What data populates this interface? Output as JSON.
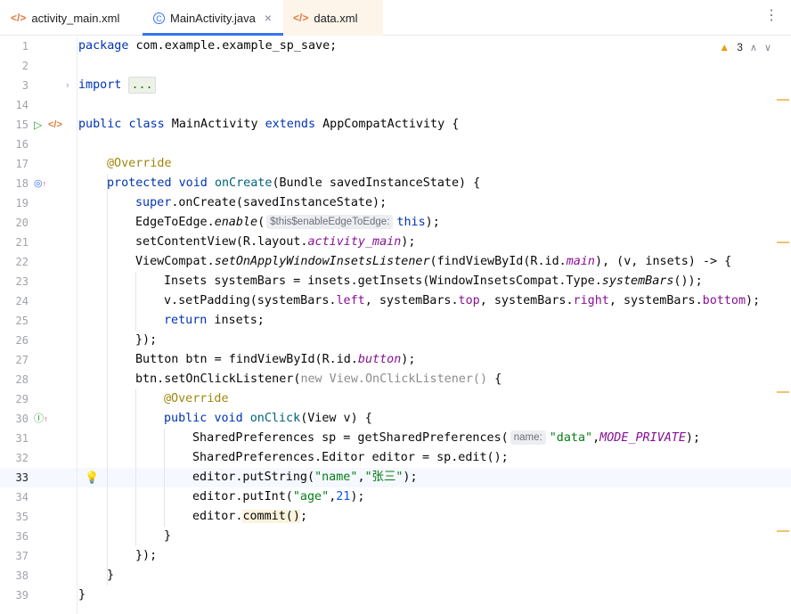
{
  "tabs": [
    {
      "label": "activity_main.xml",
      "icon": "xml-icon"
    },
    {
      "label": "MainActivity.java",
      "icon": "java-class-icon"
    },
    {
      "label": "data.xml",
      "icon": "xml-icon"
    }
  ],
  "inspection": {
    "warnings": "3"
  },
  "current_line": "33",
  "lines": [
    {
      "n": "1"
    },
    {
      "n": "2"
    },
    {
      "n": "3"
    },
    {
      "n": "14"
    },
    {
      "n": "15"
    },
    {
      "n": "16"
    },
    {
      "n": "17"
    },
    {
      "n": "18"
    },
    {
      "n": "19"
    },
    {
      "n": "20"
    },
    {
      "n": "21"
    },
    {
      "n": "22"
    },
    {
      "n": "23"
    },
    {
      "n": "24"
    },
    {
      "n": "25"
    },
    {
      "n": "26"
    },
    {
      "n": "27"
    },
    {
      "n": "28"
    },
    {
      "n": "29"
    },
    {
      "n": "30"
    },
    {
      "n": "31"
    },
    {
      "n": "32"
    },
    {
      "n": "33"
    },
    {
      "n": "34"
    },
    {
      "n": "35"
    },
    {
      "n": "36"
    },
    {
      "n": "37"
    },
    {
      "n": "38"
    },
    {
      "n": "39"
    }
  ],
  "code": {
    "l1": {
      "kw": "package",
      "rest": " com.example.example_sp_save;"
    },
    "l3": {
      "kw": "import",
      "fold": "..."
    },
    "l15": {
      "kw1": "public",
      "kw2": "class",
      "name": " MainActivity ",
      "kw3": "extends",
      "rest": " AppCompatActivity {"
    },
    "l17": {
      "ann": "@Override"
    },
    "l18": {
      "kw1": "protected",
      "kw2": "void",
      "name": "onCreate",
      "rest": "(Bundle savedInstanceState) {"
    },
    "l19": {
      "kw": "super",
      "rest": ".onCreate(savedInstanceState);"
    },
    "l20": {
      "a": "EdgeToEdge.",
      "method": "enable",
      "b": "(",
      "hint": "$this$enableEdgeToEdge:",
      "kw": "this",
      "c": ");"
    },
    "l21": {
      "a": "setContentView(R.layout.",
      "fld": "activity_main",
      "b": ");"
    },
    "l22": {
      "a": "ViewCompat.",
      "method": "setOnApplyWindowInsetsListener",
      "b": "(findViewById(R.id.",
      "fld": "main",
      "c": "), (v, insets) -> {"
    },
    "l23": {
      "a": "Insets systemBars = insets.getInsets(WindowInsetsCompat.Type.",
      "method": "systemBars",
      "b": "());"
    },
    "l24": {
      "a": "v.setPadding(systemBars.",
      "f1": "left",
      "b": ", systemBars.",
      "f2": "top",
      "c": ", systemBars.",
      "f3": "right",
      "d": ", systemBars.",
      "f4": "bottom",
      "e": ");"
    },
    "l25": {
      "kw": "return",
      "rest": " insets;"
    },
    "l26": {
      "text": "});"
    },
    "l27": {
      "a": "Button btn = findViewById(R.id.",
      "fld": "button",
      "b": ");"
    },
    "l28": {
      "a": "btn.setOnClickListener(",
      "gray": "new View.OnClickListener()",
      "b": " {"
    },
    "l29": {
      "ann": "@Override"
    },
    "l30": {
      "kw1": "public",
      "kw2": "void",
      "name": "onClick",
      "rest": "(View v) {"
    },
    "l31": {
      "a": "SharedPreferences sp = getSharedPreferences(",
      "hint": "name:",
      "str": "\"data\"",
      "b": ",",
      "fld": "MODE_PRIVATE",
      "c": ");"
    },
    "l32": {
      "text": "SharedPreferences.Editor editor = sp.edit();"
    },
    "l33": {
      "a": "editor.putString(",
      "s1": "\"name\"",
      "b": ",",
      "s2": "\"张三\"",
      "c": ");"
    },
    "l34": {
      "a": "editor.putInt(",
      "s1": "\"age\"",
      "b": ",",
      "num": "21",
      "c": ");"
    },
    "l35": {
      "a": "editor.",
      "hl": "commit()",
      "b": ";"
    },
    "l36": {
      "text": "}"
    },
    "l37": {
      "text": "});"
    },
    "l38": {
      "text": "}"
    },
    "l39": {
      "text": "}"
    }
  }
}
